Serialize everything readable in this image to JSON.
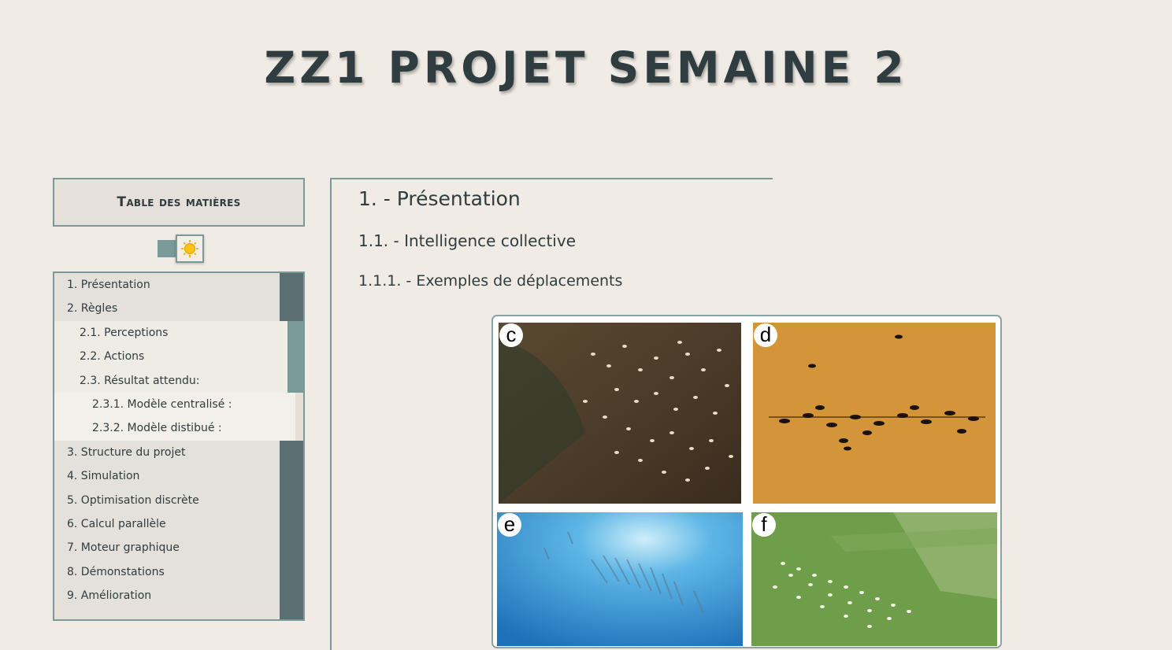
{
  "site": {
    "title": "ZZ1 PROJET SEMAINE 2"
  },
  "toc": {
    "title": "Table des matières",
    "theme_toggle": {
      "icon": "sun-icon"
    },
    "items": [
      {
        "label": "1. Présentation",
        "level": 1
      },
      {
        "label": "2. Règles",
        "level": 1
      },
      {
        "label": "2.1. Perceptions",
        "level": 2
      },
      {
        "label": "2.2. Actions",
        "level": 2
      },
      {
        "label": "2.3. Résultat attendu:",
        "level": 2
      },
      {
        "label": "2.3.1. Modèle centralisé :",
        "level": 3
      },
      {
        "label": "2.3.2. Modèle distibué :",
        "level": 3
      },
      {
        "label": "3. Structure du projet",
        "level": 1
      },
      {
        "label": "4. Simulation",
        "level": 1
      },
      {
        "label": "5. Optimisation discrète",
        "level": 1
      },
      {
        "label": "6. Calcul parallèle",
        "level": 1
      },
      {
        "label": "7. Moteur graphique",
        "level": 1
      },
      {
        "label": "8. Démonstations",
        "level": 1
      },
      {
        "label": "9. Amélioration",
        "level": 1
      }
    ]
  },
  "content": {
    "h1": "1. - Présentation",
    "h2": "1.1. - Intelligence collective",
    "h3": "1.1.1. - Exemples de déplacements",
    "figure": {
      "panels": [
        {
          "letter": "c",
          "subject": "herd-of-animals-photo"
        },
        {
          "letter": "d",
          "subject": "ant-column-photo"
        },
        {
          "letter": "e",
          "subject": "fish-school-photo"
        },
        {
          "letter": "f",
          "subject": "sheep-flock-photo"
        }
      ]
    }
  },
  "colors": {
    "background": "#f0ebe4",
    "accent": "#7a9a99",
    "accent_dark": "#5b6e71",
    "text": "#2f3d40"
  }
}
